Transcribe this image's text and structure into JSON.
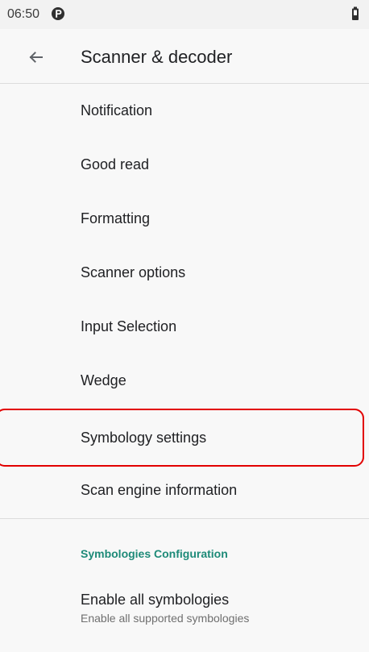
{
  "status_bar": {
    "time": "06:50",
    "notification_icon": "alert-circle-icon",
    "battery_icon": "battery-icon"
  },
  "app_bar": {
    "back_icon": "arrow-back-icon",
    "title": "Scanner & decoder"
  },
  "settings": {
    "items": [
      {
        "label": "Notification"
      },
      {
        "label": "Good read"
      },
      {
        "label": "Formatting"
      },
      {
        "label": "Scanner options"
      },
      {
        "label": "Input Selection"
      },
      {
        "label": "Wedge"
      },
      {
        "label": "Symbology settings",
        "highlighted": true
      },
      {
        "label": "Scan engine information"
      }
    ]
  },
  "symbologies_configuration": {
    "header": "Symbologies Configuration",
    "enable_all": {
      "title": "Enable all symbologies",
      "summary": "Enable all supported symbologies"
    }
  },
  "colors": {
    "accent": "#1d8a78",
    "highlight": "#e20000",
    "background": "#f8f8f8",
    "status_bar": "#f2f2f2"
  }
}
